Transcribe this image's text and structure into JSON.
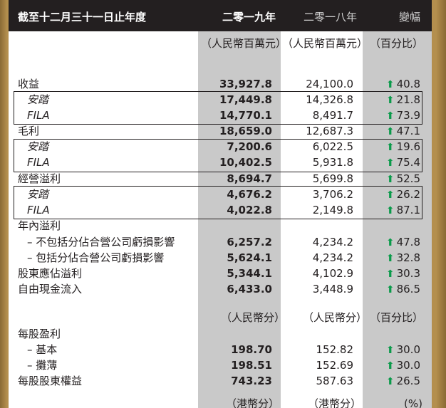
{
  "header": {
    "col_label": "截至十二月三十一日止年度",
    "col_2019": "二零一九年",
    "col_2018": "二零一八年",
    "col_change": "變幅"
  },
  "units": {
    "amount_2019": "（人民幣百萬元）",
    "amount_2018": "（人民幣百萬元）",
    "amount_change": "（百分比）",
    "cents_2019": "（人民幣分）",
    "cents_2018": "（人民幣分）",
    "cents_change": "（百分比）",
    "hk_2019": "（港幣分）",
    "hk_2018": "（港幣分）",
    "hk_change": "(%)"
  },
  "rows": [
    {
      "label": "收益",
      "v19": "33,927.8",
      "v18": "24,100.0",
      "chg": "40.8"
    },
    {
      "label": "安踏",
      "v19": "17,449.8",
      "v18": "14,326.8",
      "chg": "21.8"
    },
    {
      "label": "FILA",
      "v19": "14,770.1",
      "v18": "8,491.7",
      "chg": "73.9"
    },
    {
      "label": "毛利",
      "v19": "18,659.0",
      "v18": "12,687.3",
      "chg": "47.1"
    },
    {
      "label": "安踏",
      "v19": "7,200.6",
      "v18": "6,022.5",
      "chg": "19.6"
    },
    {
      "label": "FILA",
      "v19": "10,402.5",
      "v18": "5,931.8",
      "chg": "75.4"
    },
    {
      "label": "經營溢利",
      "v19": "8,694.7",
      "v18": "5,699.8",
      "chg": "52.5"
    },
    {
      "label": "安踏",
      "v19": "4,676.2",
      "v18": "3,706.2",
      "chg": "26.2"
    },
    {
      "label": "FILA",
      "v19": "4,022.8",
      "v18": "2,149.8",
      "chg": "87.1"
    },
    {
      "label": "年內溢利",
      "v19": "",
      "v18": "",
      "chg": ""
    },
    {
      "label": "– 不包括分佔合營公司虧損影響",
      "v19": "6,257.2",
      "v18": "4,234.2",
      "chg": "47.8"
    },
    {
      "label": "– 包括分佔合營公司虧損影響",
      "v19": "5,624.1",
      "v18": "4,234.2",
      "chg": "32.8"
    },
    {
      "label": "股東應佔溢利",
      "v19": "5,344.1",
      "v18": "4,102.9",
      "chg": "30.3"
    },
    {
      "label": "自由現金流入",
      "v19": "6,433.0",
      "v18": "3,448.9",
      "chg": "86.5"
    },
    {
      "label": "每股盈利",
      "v19": "",
      "v18": "",
      "chg": ""
    },
    {
      "label": "– 基本",
      "v19": "198.70",
      "v18": "152.82",
      "chg": "30.0"
    },
    {
      "label": "– 攤薄",
      "v19": "198.51",
      "v18": "152.69",
      "chg": "30.0"
    },
    {
      "label": "每股股東權益",
      "v19": "743.23",
      "v18": "587.63",
      "chg": "26.5"
    }
  ],
  "arrow_icon": "up-arrow-icon",
  "colors": {
    "arrow": "#0a9a4a",
    "header": "#231f20",
    "shade": "#c9c9c9"
  }
}
